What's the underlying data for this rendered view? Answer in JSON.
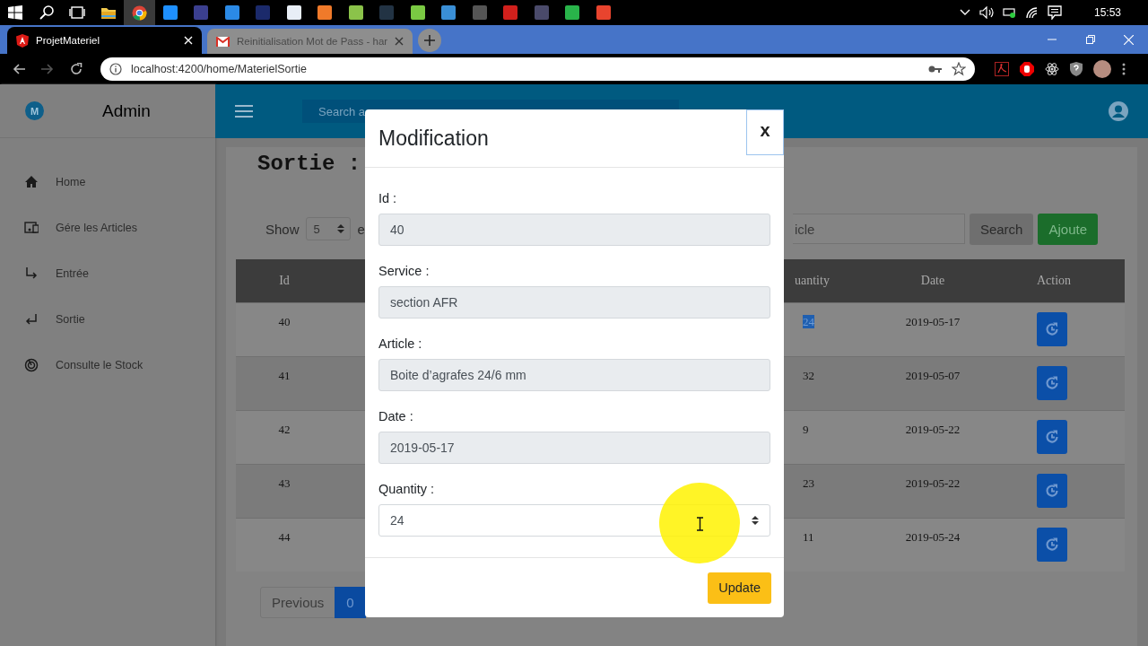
{
  "taskbar": {
    "apps": [
      {
        "kind": "start",
        "selected": false
      },
      {
        "kind": "search",
        "selected": false
      },
      {
        "kind": "taskview",
        "selected": false
      },
      {
        "kind": "folder",
        "selected": false
      },
      {
        "kind": "browser",
        "selected": true
      },
      {
        "kind": "square",
        "color": "#1e90ff",
        "selected": false
      },
      {
        "kind": "square",
        "color": "#3b3f8f",
        "selected": false
      },
      {
        "kind": "square",
        "color": "#2b8ae6",
        "selected": false
      },
      {
        "kind": "square",
        "color": "#1b2a6b",
        "selected": false
      },
      {
        "kind": "square",
        "color": "#e8eef6",
        "selected": false
      },
      {
        "kind": "square",
        "color": "#f07a2a",
        "selected": false
      },
      {
        "kind": "square",
        "color": "#8bc34a",
        "selected": false
      },
      {
        "kind": "square",
        "color": "#223344",
        "selected": false
      },
      {
        "kind": "square",
        "color": "#7ac943",
        "selected": false
      },
      {
        "kind": "square",
        "color": "#3a8fd6",
        "selected": false
      },
      {
        "kind": "square",
        "color": "#555555",
        "selected": false
      },
      {
        "kind": "square",
        "color": "#d0201c",
        "selected": false
      },
      {
        "kind": "square",
        "color": "#4a4a6a",
        "selected": false
      },
      {
        "kind": "square",
        "color": "#29b34a",
        "selected": false
      },
      {
        "kind": "square",
        "color": "#e8442e",
        "selected": false
      }
    ],
    "time": "15:53"
  },
  "browser": {
    "tabs": [
      {
        "title": "ProjetMateriel",
        "selected": true
      },
      {
        "title": "Reinitialisation Mot de Pass - har",
        "selected": false
      }
    ],
    "nav": [
      {
        "kind": "back",
        "disabled": false
      },
      {
        "kind": "forward",
        "disabled": true
      },
      {
        "kind": "reload",
        "disabled": false
      }
    ],
    "url": "localhost:4200/home/MaterielSortie"
  },
  "sidebar": {
    "avatar": "M",
    "title": "Admin",
    "items": [
      {
        "label": "Home"
      },
      {
        "label": "Gére les Articles"
      },
      {
        "label": "Entrée"
      },
      {
        "label": "Sortie"
      },
      {
        "label": "Consulte le Stock"
      }
    ]
  },
  "header": {
    "search_placeholder": "Search a"
  },
  "page": {
    "title": "Sortie :",
    "show_label": "Show",
    "page_size": "5",
    "after_size": "e",
    "search_placeholder": "icle",
    "buttons": [
      {
        "label": "Search",
        "kind": "secondary"
      },
      {
        "label": "Ajoute",
        "kind": "success"
      }
    ]
  },
  "table": {
    "columns": [
      "Id",
      "uantity",
      "Date",
      "Action"
    ],
    "rows": [
      {
        "id": "40",
        "quantity": "24",
        "date": "2019-05-17",
        "text_selected": true
      },
      {
        "id": "41",
        "quantity": "32",
        "date": "2019-05-07",
        "text_selected": false
      },
      {
        "id": "42",
        "quantity": "9",
        "date": "2019-05-22",
        "text_selected": false
      },
      {
        "id": "43",
        "quantity": "23",
        "date": "2019-05-22",
        "text_selected": false
      },
      {
        "id": "44",
        "quantity": "11",
        "date": "2019-05-24",
        "text_selected": false
      }
    ]
  },
  "pagination": [
    {
      "label": "Previous",
      "selected": false
    },
    {
      "label": "0",
      "selected": true
    }
  ],
  "modal": {
    "title": "Modification",
    "close": "x",
    "fields": [
      {
        "label": "Id :",
        "value": "40",
        "kind": "text",
        "readonly": true
      },
      {
        "label": "Service :",
        "value": "section AFR",
        "kind": "text",
        "readonly": true
      },
      {
        "label": "Article :",
        "value": "Boite d’agrafes 24/6 mm",
        "kind": "text",
        "readonly": true
      },
      {
        "label": "Date :",
        "value": "2019-05-17",
        "kind": "text",
        "readonly": true
      },
      {
        "label": "Quantity :",
        "value": "24",
        "kind": "number",
        "readonly": false
      }
    ],
    "submit": "Update"
  }
}
